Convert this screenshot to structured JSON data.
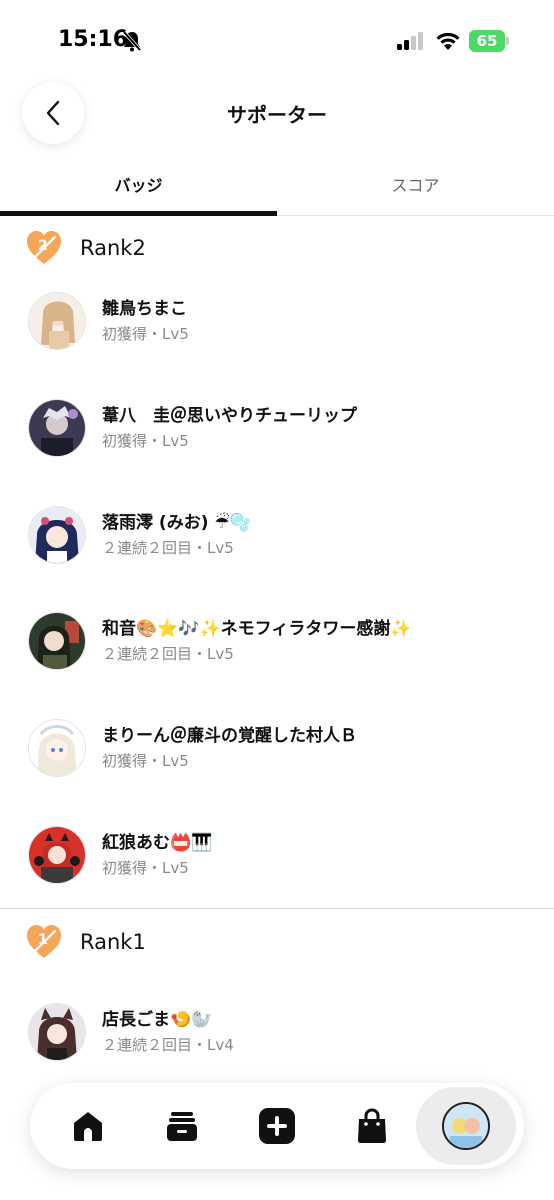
{
  "status_bar": {
    "time": "15:16",
    "battery": "65"
  },
  "header": {
    "title": "サポーター"
  },
  "tabs": [
    {
      "label": "バッジ",
      "active": true
    },
    {
      "label": "スコア",
      "active": false
    }
  ],
  "sections": [
    {
      "rank_label": "Rank2",
      "rank_number": "2",
      "supporters": [
        {
          "name": "雛鳥ちまこ",
          "sub": "初獲得・Lv5"
        },
        {
          "name": "葦八　圭＠思いやりチューリップ",
          "sub": "初獲得・Lv5"
        },
        {
          "name": "落雨澪 (みお) ☔🫧",
          "sub": "２連続２回目・Lv5"
        },
        {
          "name": "和音🎨⭐🎶✨ネモフィラタワー感謝✨",
          "sub": "２連続２回目・Lv5"
        },
        {
          "name": "まりーん＠廉斗の覚醒した村人Ｂ",
          "sub": "初獲得・Lv5"
        },
        {
          "name": "紅狼あむ📛🎹",
          "sub": "初獲得・Lv5"
        }
      ]
    },
    {
      "rank_label": "Rank1",
      "rank_number": "1",
      "supporters": [
        {
          "name": "店長ごま🍤🦭",
          "sub": "２連続２回目・Lv4"
        }
      ]
    }
  ],
  "colors": {
    "accent": "#111111",
    "rank_heart": "#f7a559",
    "battery": "#4cd964"
  },
  "nav": [
    {
      "icon": "home-icon"
    },
    {
      "icon": "stack-icon"
    },
    {
      "icon": "plus-icon"
    },
    {
      "icon": "shopping-bag-icon"
    },
    {
      "icon": "profile-avatar"
    }
  ]
}
